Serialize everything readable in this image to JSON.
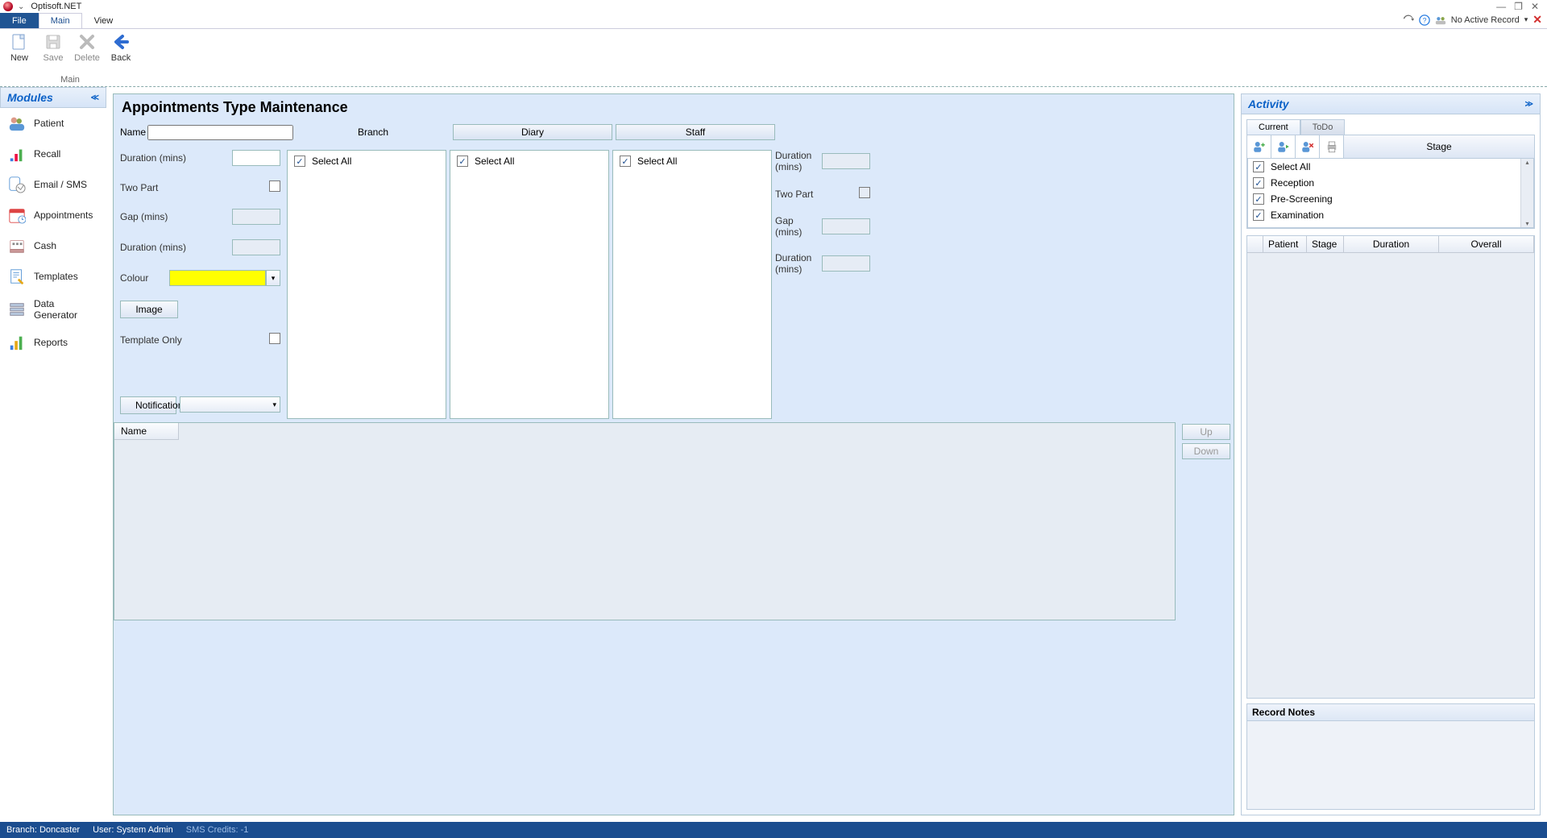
{
  "app": {
    "title": "Optisoft.NET"
  },
  "window_controls": {
    "minimize": "—",
    "restore": "❐",
    "close": "✕"
  },
  "titlebar_status": {
    "text": "No Active Record",
    "has_dropdown": true
  },
  "ribbon": {
    "tabs": {
      "file": "File",
      "main": "Main",
      "view": "View",
      "active": "Main"
    },
    "group_main_label": "Main",
    "buttons": {
      "new": {
        "label": "New",
        "enabled": true
      },
      "save": {
        "label": "Save",
        "enabled": false
      },
      "delete": {
        "label": "Delete",
        "enabled": false
      },
      "back": {
        "label": "Back",
        "enabled": true
      }
    }
  },
  "modules": {
    "header": "Modules",
    "items": [
      {
        "label": "Patient"
      },
      {
        "label": "Recall"
      },
      {
        "label": "Email / SMS"
      },
      {
        "label": "Appointments"
      },
      {
        "label": "Cash"
      },
      {
        "label": "Templates"
      },
      {
        "label": "Data Generator"
      },
      {
        "label": "Reports"
      }
    ]
  },
  "form": {
    "title": "Appointments Type Maintenance",
    "labels": {
      "name": "Name",
      "branch": "Branch",
      "diary": "Diary",
      "staff": "Staff",
      "duration": "Duration (mins)",
      "two_part": "Two Part",
      "gap": "Gap (mins)",
      "duration2": "Duration (mins)",
      "colour": "Colour",
      "image": "Image",
      "template_only": "Template Only",
      "notification": "Notification",
      "select_all": "Select All"
    },
    "values": {
      "name": "",
      "duration_left": "",
      "two_part_left": false,
      "gap_left": "",
      "duration2_left": "",
      "colour": "#ffff00",
      "template_only": false,
      "branch_select_all": true,
      "diary_select_all": true,
      "staff_select_all": true,
      "duration_right": "",
      "two_part_right": false,
      "gap_right": "",
      "duration2_right": "",
      "notification": ""
    },
    "lower_grid": {
      "name_header": "Name"
    },
    "lower_buttons": {
      "up": "Up",
      "down": "Down"
    }
  },
  "activity": {
    "header": "Activity",
    "tabs": {
      "current": "Current",
      "todo": "ToDo"
    },
    "stage_button": "Stage",
    "stage_list": {
      "select_all": {
        "label": "Select All",
        "checked": true
      },
      "items": [
        {
          "label": "Reception",
          "checked": true
        },
        {
          "label": "Pre-Screening",
          "checked": true
        },
        {
          "label": "Examination",
          "checked": true
        }
      ]
    },
    "grid_headers": {
      "patient": "Patient",
      "stage": "Stage",
      "duration": "Duration",
      "overall": "Overall"
    },
    "record_notes_header": "Record Notes"
  },
  "statusbar": {
    "branch": "Branch: Doncaster",
    "user": "User: System Admin",
    "sms": "SMS Credits: -1"
  }
}
